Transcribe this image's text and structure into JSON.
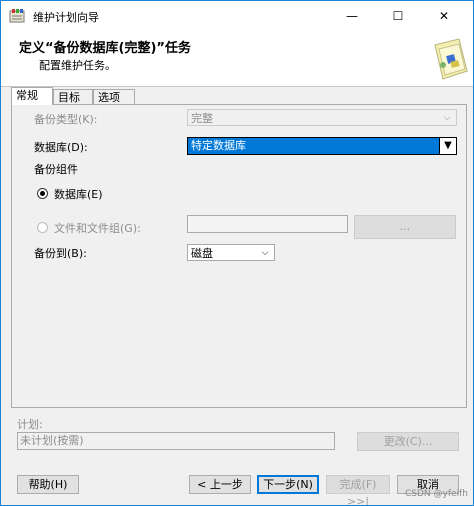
{
  "window": {
    "title": "维护计划向导",
    "minimize": "—",
    "maximize": "☐",
    "close": "✕"
  },
  "header": {
    "title": "定义“备份数据库(完整)”任务",
    "subtitle": "配置维护任务。"
  },
  "tabs": [
    {
      "label": "常规"
    },
    {
      "label": "目标"
    },
    {
      "label": "选项"
    }
  ],
  "form": {
    "backup_type_label": "备份类型(K):",
    "backup_type_value": "完整",
    "database_label": "数据库(D):",
    "database_value": "特定数据库",
    "backup_component_label": "备份组件",
    "radio_database_label": "数据库(E)",
    "radio_files_label": "文件和文件组(G):",
    "files_browse_label": "...",
    "backup_to_label": "备份到(B):",
    "backup_to_value": "磁盘"
  },
  "schedule": {
    "label": "计划:",
    "value": "未计划(按需)",
    "change_label": "更改(C)..."
  },
  "buttons": {
    "help": "帮助(H)",
    "prev": "< 上一步",
    "next": "下一步(N)",
    "finish": "完成(F) >>|",
    "cancel": "取消"
  },
  "watermark": "CSDN @yfeifh"
}
